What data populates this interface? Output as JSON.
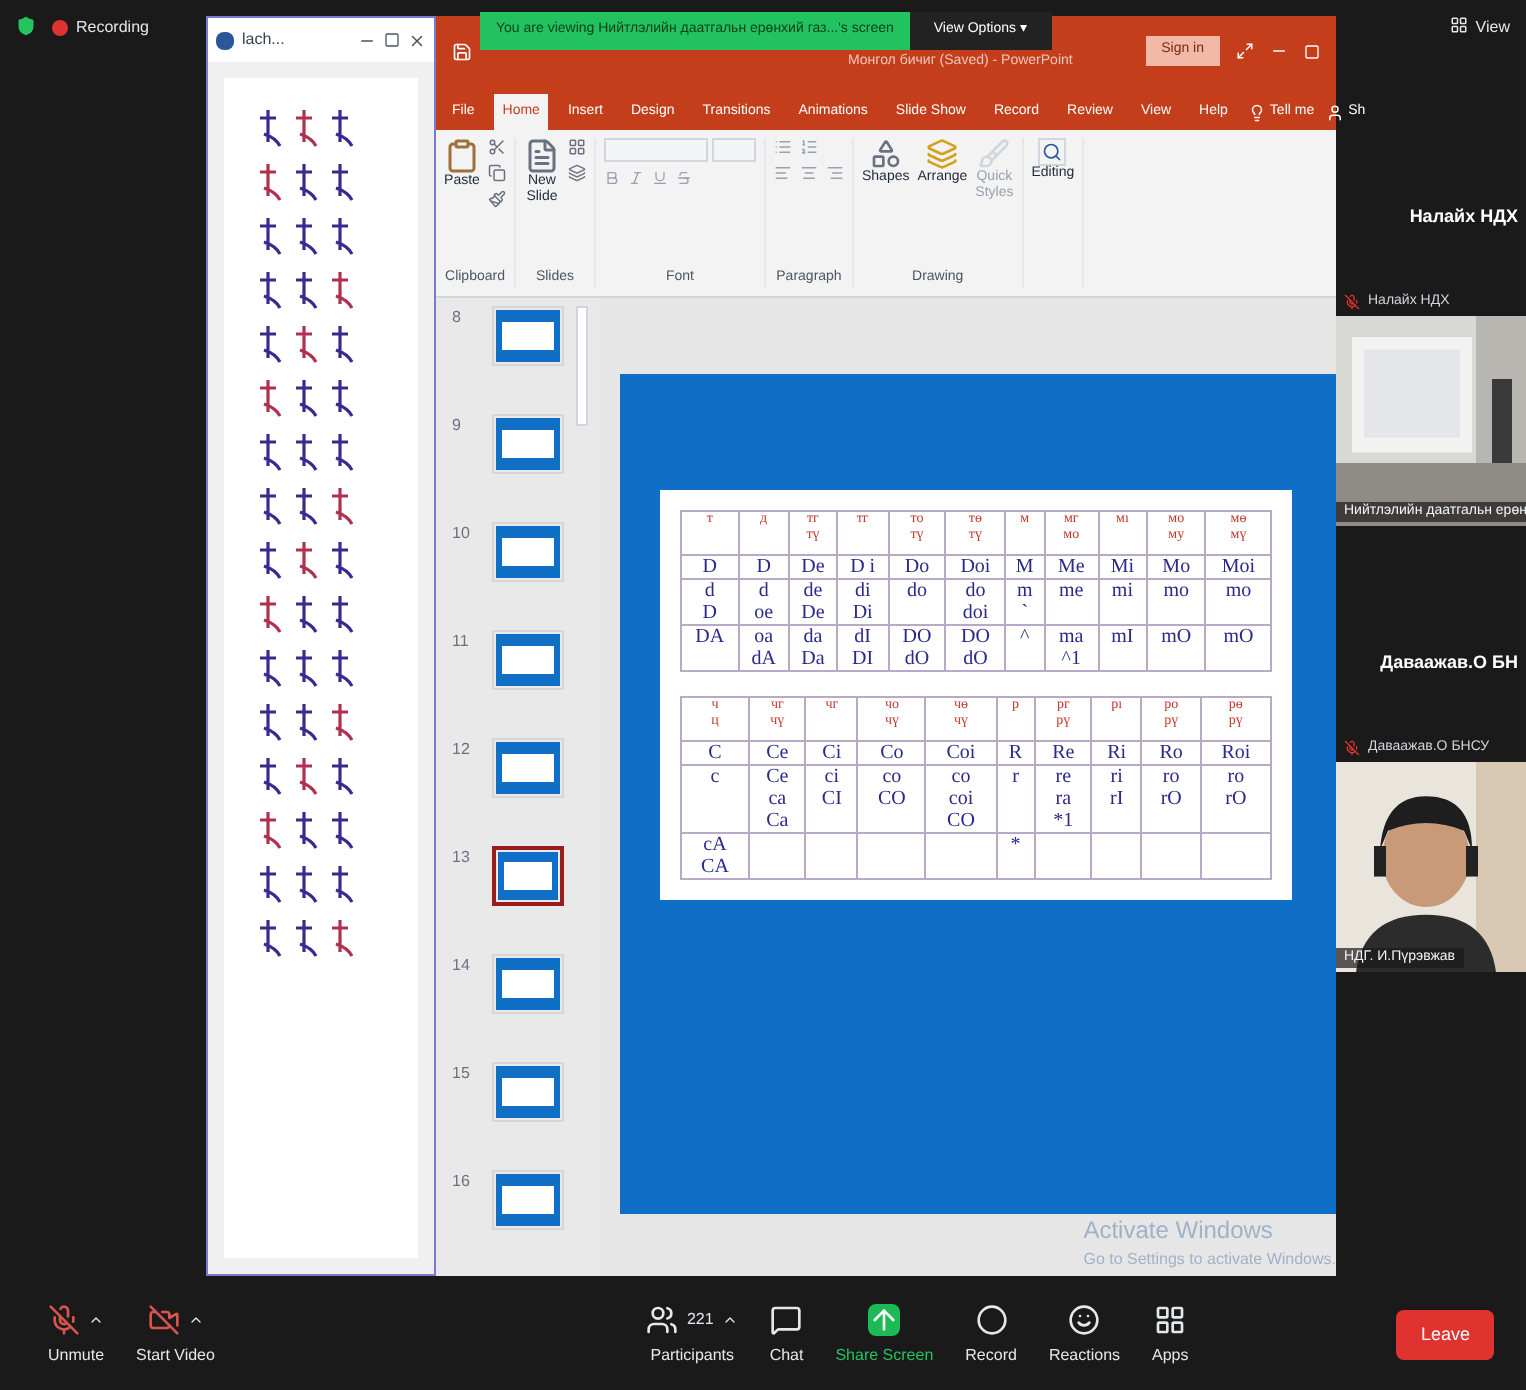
{
  "meeting": {
    "recording_label": "Recording",
    "view_label": "View"
  },
  "banner": {
    "text": "You are viewing Нийтлэлийн даатгальн ерөнхий газ...'s screen",
    "options": "View Options ▾"
  },
  "doc_window": {
    "title": "lach..."
  },
  "ppt": {
    "title": "Монгол бичиг (Saved) - PowerPoint",
    "sign_in": "Sign in",
    "tell_me": "Tell me",
    "share": "Sh",
    "tabs": [
      {
        "label": "File",
        "selected": false
      },
      {
        "label": "Home",
        "selected": true
      },
      {
        "label": "Insert",
        "selected": false
      },
      {
        "label": "Design",
        "selected": false
      },
      {
        "label": "Transitions",
        "selected": false
      },
      {
        "label": "Animations",
        "selected": false
      },
      {
        "label": "Slide Show",
        "selected": false
      },
      {
        "label": "Record",
        "selected": false
      },
      {
        "label": "Review",
        "selected": false
      },
      {
        "label": "View",
        "selected": false
      },
      {
        "label": "Help",
        "selected": false
      }
    ],
    "groups": [
      {
        "kind": "clipboard",
        "label": "Clipboard",
        "buttons": [
          {
            "label": "Paste",
            "disabled": false
          }
        ]
      },
      {
        "kind": "slides",
        "label": "Slides",
        "buttons": [
          {
            "label": "New\nSlide",
            "disabled": false
          }
        ]
      },
      {
        "kind": "font",
        "label": "Font"
      },
      {
        "kind": "paragraph",
        "label": "Paragraph"
      },
      {
        "kind": "drawing",
        "label": "Drawing",
        "buttons": [
          {
            "label": "Shapes",
            "disabled": false
          },
          {
            "label": "Arrange",
            "disabled": false
          },
          {
            "label": "Quick\nStyles",
            "disabled": true
          }
        ]
      },
      {
        "kind": "editing",
        "buttons": [
          {
            "label": "Editing",
            "disabled": false
          }
        ]
      }
    ]
  },
  "slides": [
    {
      "number": "8",
      "selected": false
    },
    {
      "number": "9",
      "selected": false
    },
    {
      "number": "10",
      "selected": false
    },
    {
      "number": "11",
      "selected": false
    },
    {
      "number": "12",
      "selected": false
    },
    {
      "number": "13",
      "selected": true
    },
    {
      "number": "14",
      "selected": false
    },
    {
      "number": "15",
      "selected": false
    },
    {
      "number": "16",
      "selected": false
    }
  ],
  "tables": [
    {
      "header": [
        "т",
        "д",
        "тг\nтү",
        "тг",
        "то\nтү",
        "тө\nтү",
        "м",
        "мг\nмо",
        "мı",
        "мо\nму",
        "мө\nмү"
      ],
      "rows": [
        [
          "D",
          "D",
          "De",
          "D i",
          "Do",
          "Doi",
          "M",
          "Me",
          "Mi",
          "Mo",
          "Moi"
        ],
        [
          "d\nD",
          "d\noe",
          "de\nDe",
          "di\nDi",
          "do",
          "do\ndoi",
          "m\n`",
          "me",
          "mi",
          "mo",
          "mo"
        ],
        [
          "DA",
          "oa\ndA",
          "da\nDa",
          "dI\nDI",
          "DO\ndO",
          "DO\ndO",
          "^",
          "ma\n^1",
          "mI",
          "mO",
          "mO"
        ]
      ]
    },
    {
      "header": [
        "ч\nц",
        "чг\nчү",
        "чг",
        "чо\nчү",
        "чө\nчү",
        "р",
        "рг\nрү",
        "рı",
        "ро\nрү",
        "рө\nрү"
      ],
      "rows": [
        [
          "C",
          "Ce",
          "Ci",
          "Co",
          "Coi",
          "R",
          "Re",
          "Ri",
          "Ro",
          "Roi"
        ],
        [
          "c",
          "Ce\nca\nCa",
          "ci\nCI",
          "co\nCO",
          "co\ncoi\nCO",
          "r",
          "re\nra\n*1",
          "ri\nrI",
          "ro\nrO",
          "ro\nrO"
        ],
        [
          "cA\nCA",
          null,
          null,
          null,
          null,
          "*",
          null,
          null,
          null,
          null
        ]
      ]
    }
  ],
  "activation": {
    "title": "Activate Windows",
    "subtitle": "Go to Settings to activate Windows."
  },
  "participants": [
    {
      "heading": "Налайх НДХ",
      "tile_name": "Налайх НДХ",
      "caption": "Нийтлэлийн даатгальн ерөн",
      "kind": "screen"
    },
    {
      "heading": "Даваажав.О БН",
      "tile_name": "Даваажав.О БНСУ",
      "caption": "НДГ. И.Пүрэвжав",
      "kind": "camera"
    }
  ],
  "toolbar": {
    "items": [
      {
        "kind": "mic",
        "label": "Unmute"
      },
      {
        "kind": "video",
        "label": "Start Video"
      },
      {
        "kind": "participants",
        "label": "Participants",
        "count": "221"
      },
      {
        "kind": "chat",
        "label": "Chat"
      },
      {
        "kind": "share",
        "label": "Share Screen"
      },
      {
        "kind": "record",
        "label": "Record"
      },
      {
        "kind": "reactions",
        "label": "Reactions"
      },
      {
        "kind": "apps",
        "label": "Apps"
      }
    ],
    "leave": "Leave"
  }
}
